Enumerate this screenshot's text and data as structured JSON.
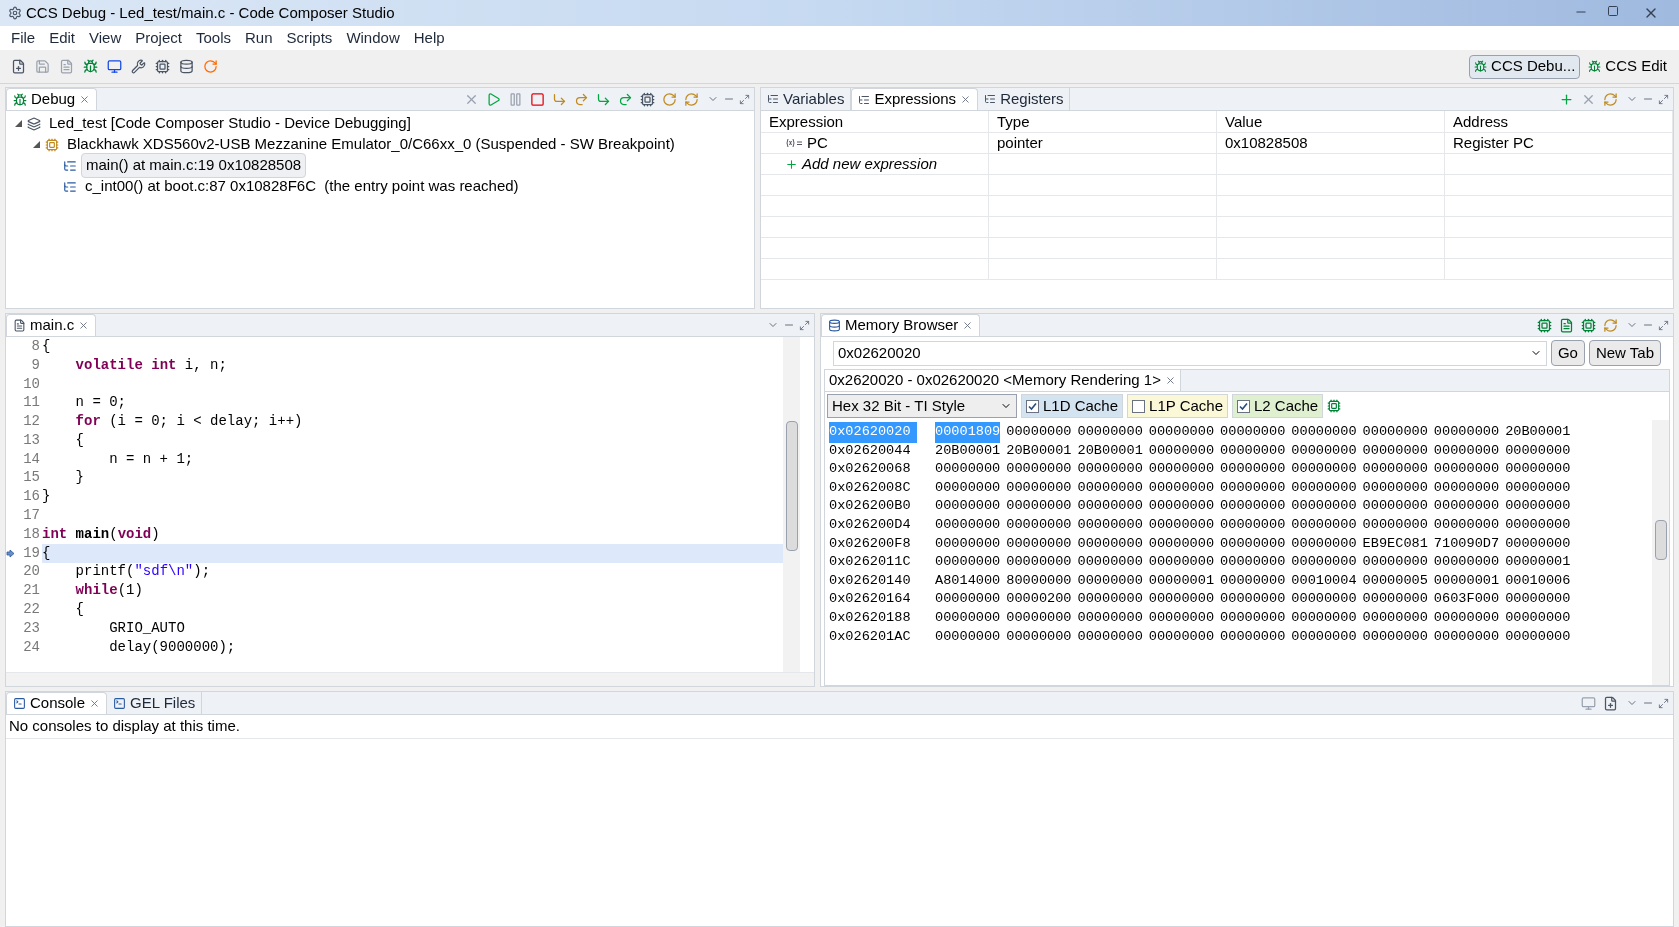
{
  "window": {
    "title": "CCS Debug - Led_test/main.c - Code Composer Studio"
  },
  "menu": [
    "File",
    "Edit",
    "View",
    "Project",
    "Tools",
    "Run",
    "Scripts",
    "Window",
    "Help"
  ],
  "perspectives": [
    {
      "label": "CCS Debu...",
      "selected": true
    },
    {
      "label": "CCS Edit",
      "selected": false
    }
  ],
  "debug": {
    "title": "Debug",
    "tree": [
      {
        "label": "Led_test [Code Composer Studio - Device Debugging]",
        "kind": "project",
        "expanded": true,
        "children": [
          {
            "label": "Blackhawk XDS560v2-USB Mezzanine Emulator_0/C66xx_0 (Suspended - SW Breakpoint)",
            "kind": "core",
            "expanded": true,
            "children": [
              {
                "label": "main() at main.c:19 0x10828508",
                "kind": "frame",
                "selected": true
              },
              {
                "label": "c_int00() at boot.c:87 0x10828F6C  (the entry point was reached)",
                "kind": "frame",
                "selected": false
              }
            ]
          }
        ]
      }
    ]
  },
  "expressions": {
    "tabs": [
      {
        "label": "Variables",
        "selected": false
      },
      {
        "label": "Expressions",
        "selected": true
      },
      {
        "label": "Registers",
        "selected": false
      }
    ],
    "columns": [
      "Expression",
      "Type",
      "Value",
      "Address"
    ],
    "rows": [
      [
        "PC",
        "pointer",
        "0x10828508",
        "Register PC"
      ]
    ],
    "add_label": "Add new expression"
  },
  "editor": {
    "tab": "main.c",
    "lines": [
      {
        "number": "8",
        "current": false,
        "tokens": [
          {
            "text": "{",
            "kind": "plain"
          }
        ]
      },
      {
        "number": "9",
        "current": false,
        "tokens": [
          {
            "text": "    volatile",
            "kind": "keyword"
          },
          {
            "text": " int",
            "kind": "keyword"
          },
          {
            "text": " i, n;",
            "kind": "plain"
          }
        ]
      },
      {
        "number": "10",
        "current": false
      },
      {
        "number": "11",
        "current": false,
        "tokens": [
          {
            "text": "    n = 0;",
            "kind": "plain"
          }
        ]
      },
      {
        "number": "12",
        "current": false,
        "tokens": [
          {
            "text": "    for",
            "kind": "keyword"
          },
          {
            "text": " (i = 0; i < delay; i++)",
            "kind": "plain"
          }
        ]
      },
      {
        "number": "13",
        "current": false,
        "tokens": [
          {
            "text": "    {",
            "kind": "plain"
          }
        ]
      },
      {
        "number": "14",
        "current": false,
        "tokens": [
          {
            "text": "        n = n + 1;",
            "kind": "plain"
          }
        ]
      },
      {
        "number": "15",
        "current": false,
        "tokens": [
          {
            "text": "    }",
            "kind": "plain"
          }
        ]
      },
      {
        "number": "16",
        "current": false,
        "tokens": [
          {
            "text": "}",
            "kind": "plain"
          }
        ]
      },
      {
        "number": "17",
        "current": false
      },
      {
        "number": "18",
        "current": false,
        "tokens": [
          {
            "text": "int",
            "kind": "keyword"
          },
          {
            "text": " main",
            "kind": "bold"
          },
          {
            "text": "(",
            "kind": "plain"
          },
          {
            "text": "void",
            "kind": "keyword"
          },
          {
            "text": ")",
            "kind": "plain"
          }
        ]
      },
      {
        "number": "19",
        "current": true,
        "tokens": [
          {
            "text": "{",
            "kind": "plain"
          }
        ]
      },
      {
        "number": "20",
        "current": false,
        "tokens": [
          {
            "text": "    printf(",
            "kind": "plain"
          },
          {
            "text": "\"sdf\\n\"",
            "kind": "string"
          },
          {
            "text": ");",
            "kind": "plain"
          }
        ]
      },
      {
        "number": "21",
        "current": false,
        "tokens": [
          {
            "text": "    while",
            "kind": "keyword"
          },
          {
            "text": "(1)",
            "kind": "plain"
          }
        ]
      },
      {
        "number": "22",
        "current": false,
        "tokens": [
          {
            "text": "    {",
            "kind": "plain"
          }
        ]
      },
      {
        "number": "23",
        "current": false,
        "tokens": [
          {
            "text": "        GRIO_AUTO",
            "kind": "plain"
          }
        ]
      },
      {
        "number": "24",
        "current": false,
        "tokens": [
          {
            "text": "        delay(9000000);",
            "kind": "plain"
          }
        ]
      }
    ]
  },
  "memory": {
    "title": "Memory Browser",
    "address": "0x02620020",
    "go": "Go",
    "new_tab": "New Tab",
    "rendering_tab": "0x2620020 - 0x02620020 <Memory Rendering 1>",
    "format": "Hex 32 Bit - TI Style",
    "caches": [
      {
        "label": "L1D Cache",
        "checked": true,
        "color": "#d4e3f0"
      },
      {
        "label": "L1P Cache",
        "checked": false,
        "color": "#fbf8d8"
      },
      {
        "label": "L2 Cache",
        "checked": true,
        "color": "#dff0d0"
      }
    ],
    "rows": [
      {
        "address": "0x02620020",
        "selected": true,
        "words": [
          "00001809",
          "00000000",
          "00000000",
          "00000000",
          "00000000",
          "00000000",
          "00000000",
          "00000000",
          "20B00001"
        ]
      },
      {
        "address": "0x02620044",
        "selected": false,
        "words": [
          "20B00001",
          "20B00001",
          "20B00001",
          "00000000",
          "00000000",
          "00000000",
          "00000000",
          "00000000",
          "00000000"
        ]
      },
      {
        "address": "0x02620068",
        "selected": false,
        "words": [
          "00000000",
          "00000000",
          "00000000",
          "00000000",
          "00000000",
          "00000000",
          "00000000",
          "00000000",
          "00000000"
        ]
      },
      {
        "address": "0x0262008C",
        "selected": false,
        "words": [
          "00000000",
          "00000000",
          "00000000",
          "00000000",
          "00000000",
          "00000000",
          "00000000",
          "00000000",
          "00000000"
        ]
      },
      {
        "address": "0x026200B0",
        "selected": false,
        "words": [
          "00000000",
          "00000000",
          "00000000",
          "00000000",
          "00000000",
          "00000000",
          "00000000",
          "00000000",
          "00000000"
        ]
      },
      {
        "address": "0x026200D4",
        "selected": false,
        "words": [
          "00000000",
          "00000000",
          "00000000",
          "00000000",
          "00000000",
          "00000000",
          "00000000",
          "00000000",
          "00000000"
        ]
      },
      {
        "address": "0x026200F8",
        "selected": false,
        "words": [
          "00000000",
          "00000000",
          "00000000",
          "00000000",
          "00000000",
          "00000000",
          "EB9EC081",
          "710090D7",
          "00000000"
        ]
      },
      {
        "address": "0x0262011C",
        "selected": false,
        "words": [
          "00000000",
          "00000000",
          "00000000",
          "00000000",
          "00000000",
          "00000000",
          "00000000",
          "00000000",
          "00000001"
        ]
      },
      {
        "address": "0x02620140",
        "selected": false,
        "words": [
          "A8014000",
          "80000000",
          "00000000",
          "00000001",
          "00000000",
          "00010004",
          "00000005",
          "00000001",
          "00010006"
        ]
      },
      {
        "address": "0x02620164",
        "selected": false,
        "words": [
          "00000000",
          "00000200",
          "00000000",
          "00000000",
          "00000000",
          "00000000",
          "00000000",
          "0603F000",
          "00000000"
        ]
      },
      {
        "address": "0x02620188",
        "selected": false,
        "words": [
          "00000000",
          "00000000",
          "00000000",
          "00000000",
          "00000000",
          "00000000",
          "00000000",
          "00000000",
          "00000000"
        ]
      },
      {
        "address": "0x026201AC",
        "selected": false,
        "words": [
          "00000000",
          "00000000",
          "00000000",
          "00000000",
          "00000000",
          "00000000",
          "00000000",
          "00000000",
          "00000000"
        ]
      }
    ]
  },
  "console": {
    "tabs": [
      {
        "label": "Console",
        "selected": true
      },
      {
        "label": "GEL Files",
        "selected": false
      }
    ],
    "message": "No consoles to display at this time."
  }
}
